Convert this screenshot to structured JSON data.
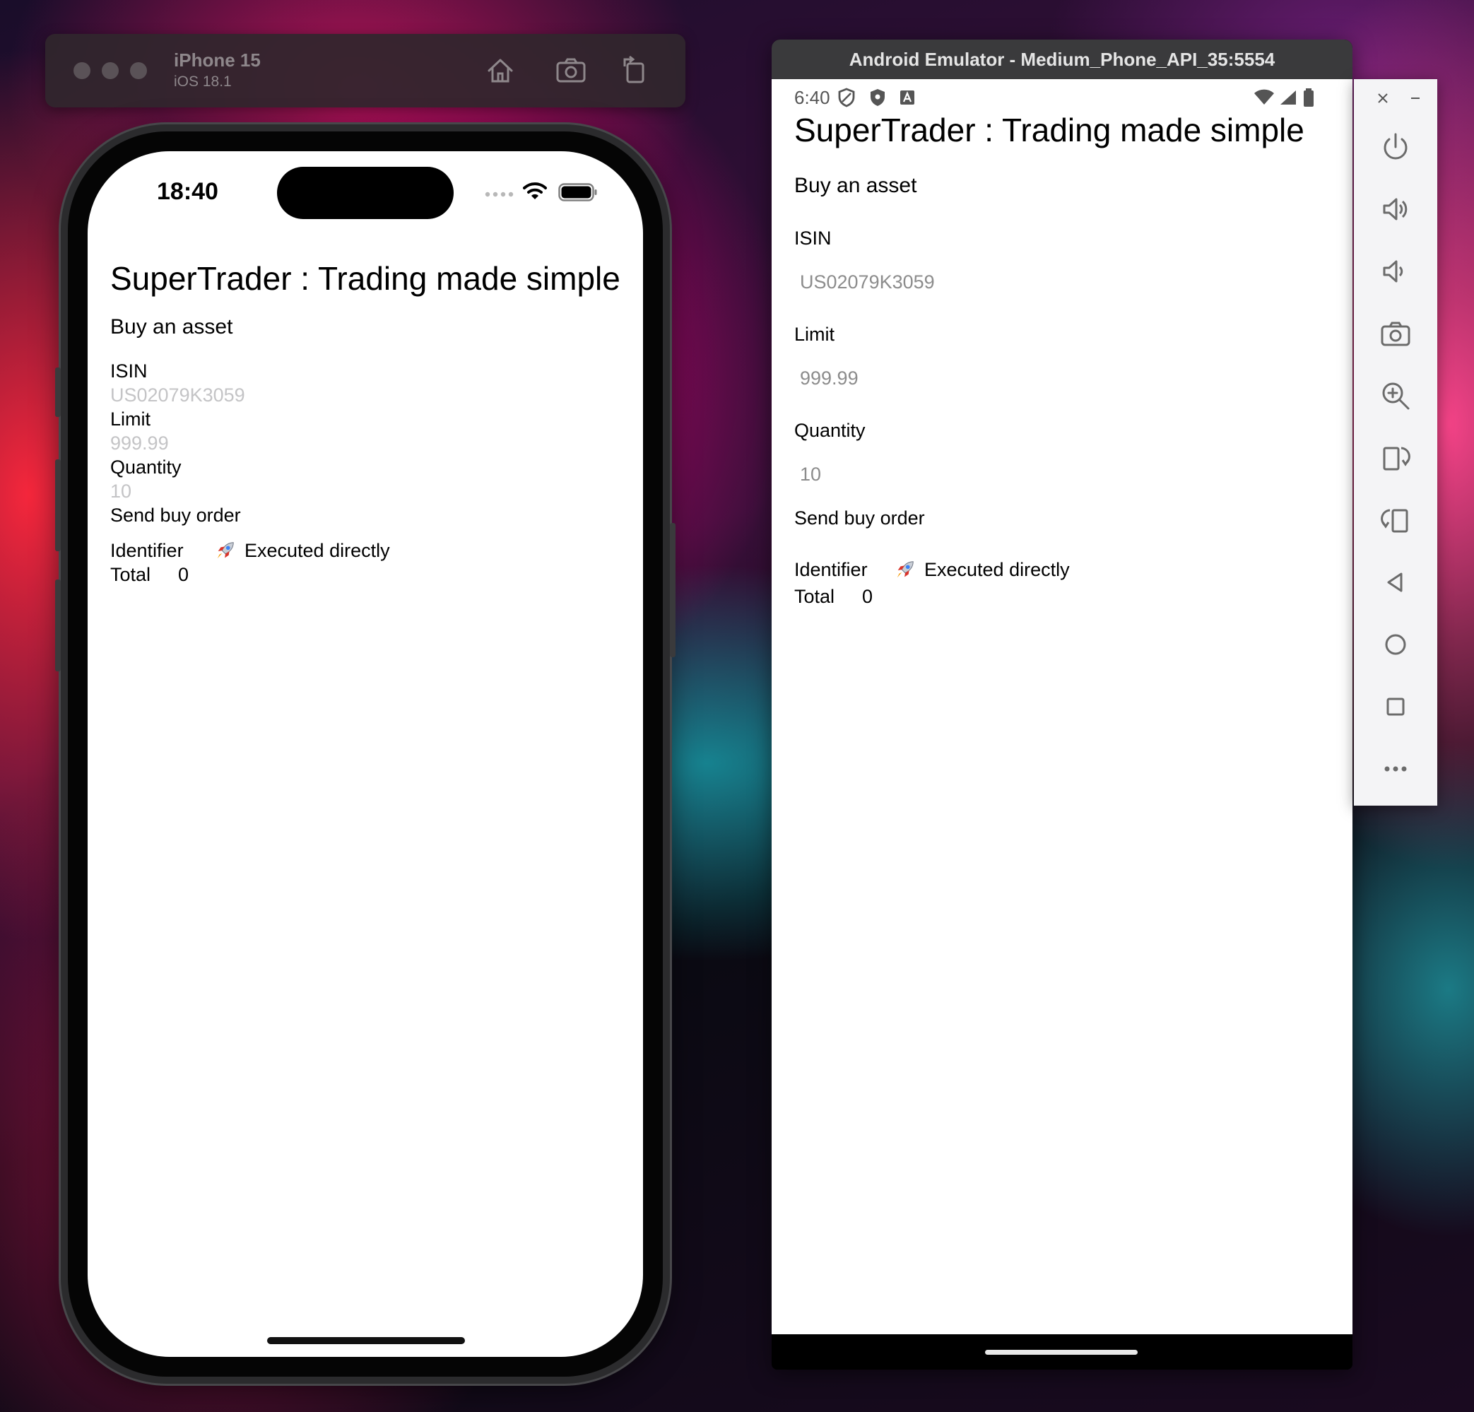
{
  "ios_simulator": {
    "device_name": "iPhone 15",
    "os_version": "iOS 18.1",
    "status_time": "18:40",
    "toolbar_buttons": [
      "home-icon",
      "screenshot-icon",
      "rotate-icon"
    ]
  },
  "android_emulator": {
    "window_title": "Android Emulator - Medium_Phone_API_35:5554",
    "status_time": "6:40",
    "side_panel_buttons": [
      "power-icon",
      "volume-up-icon",
      "volume-down-icon",
      "camera-icon",
      "zoom-icon",
      "rotate-left-icon",
      "rotate-right-icon",
      "back-icon",
      "home-icon",
      "overview-icon",
      "more-icon"
    ]
  },
  "app": {
    "title": "SuperTrader : Trading made simple",
    "subtitle": "Buy an asset",
    "isin_label": "ISIN",
    "isin_placeholder": "US02079K3059",
    "limit_label": "Limit",
    "limit_placeholder": "999.99",
    "quantity_label": "Quantity",
    "quantity_placeholder": "10",
    "send_button": "Send buy order",
    "identifier_label": "Identifier",
    "identifier_value": "Executed directly",
    "identifier_icon": "rocket-icon",
    "total_label": "Total",
    "total_value": "0"
  },
  "colors": {
    "ios_placeholder": "#c4c4c6",
    "android_placeholder": "#8c8c8c",
    "emulator_titlebar": "#3a3a3c",
    "emulator_panel": "#f4f4f6"
  }
}
